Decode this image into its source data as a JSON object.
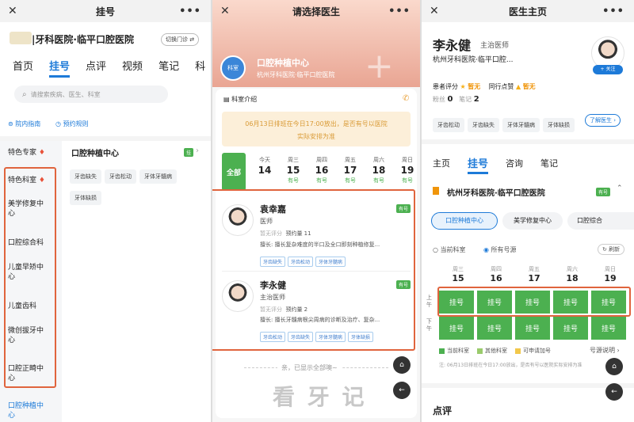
{
  "panel1": {
    "title": "挂号",
    "hospital": "|牙科医院·临平口腔医院",
    "switch_label": "切换门诊",
    "tabs": [
      "首页",
      "挂号",
      "点评",
      "视频",
      "笔记",
      "科"
    ],
    "search_placeholder": "请搜索疾病、医生、科室",
    "guide": "院内指南",
    "rules": "预约规则",
    "categories": [
      "特色专家",
      "特色科室",
      "美学修复中心",
      "口腔综合科",
      "儿童早矫中心",
      "儿童齿科",
      "微创拔牙中心",
      "口腔正畸中心",
      "口腔种植中心"
    ],
    "dept_title": "口腔种植中心",
    "dept_badge": "挂",
    "chips": [
      "牙齿缺失",
      "牙齿松动",
      "牙体牙髓病",
      "牙体缺损"
    ]
  },
  "panel2": {
    "title": "请选择医生",
    "center_name": "口腔种植中心",
    "center_hospital": "杭州牙科医院·临平口腔医院",
    "center_logo": "科室",
    "intro": "科室介绍",
    "notice_line1": "06月13日排班在今日17:00放出，是否有号以医院",
    "notice_line2": "实际安排为准",
    "all_label": "全部",
    "days": [
      {
        "wk": "今天",
        "d": "14",
        "s": ""
      },
      {
        "wk": "周三",
        "d": "15",
        "s": "有号"
      },
      {
        "wk": "周四",
        "d": "16",
        "s": "有号"
      },
      {
        "wk": "周五",
        "d": "17",
        "s": "有号"
      },
      {
        "wk": "周六",
        "d": "18",
        "s": "有号"
      },
      {
        "wk": "周日",
        "d": "19",
        "s": "有号"
      }
    ],
    "doctors": [
      {
        "name": "袁幸嘉",
        "title": "医师",
        "rating": "暂无评分",
        "booked": "预约量 11",
        "specialty": "擅长: 擅长复杂难度的半口及全口即刻种植修复...",
        "tags": [
          "牙齿缺失",
          "牙齿松动",
          "牙体牙髓病"
        ],
        "badge": "有号"
      },
      {
        "name": "李永健",
        "title": "主治医师",
        "rating": "暂无评分",
        "booked": "预约量 2",
        "specialty": "擅长: 擅长牙髓病根尖周病的诊断及治疗、复杂...",
        "tags": [
          "牙齿松动",
          "牙齿缺失",
          "牙体牙髓病",
          "牙体缺损"
        ],
        "badge": "有号"
      }
    ],
    "end_text": "亲，已显示全部噢~",
    "watermark": "看 牙 记",
    "home_label": "首页",
    "back_label": "返回"
  },
  "panel3": {
    "title": "医生主页",
    "name": "李永健",
    "position": "主治医师",
    "hospital": "杭州牙科医院·临平口腔...",
    "follow": "+ 关注",
    "rating_label": "患者评分",
    "rating_value": "暂无",
    "peer_label": "同行点赞",
    "peer_value": "暂无",
    "fans_label": "粉丝",
    "fans_value": "0",
    "notes_label": "笔记",
    "notes_value": "2",
    "tags": [
      "牙齿松动",
      "牙齿缺失",
      "牙体牙髓病",
      "牙体缺损"
    ],
    "learn_more": "了解医生",
    "tabs": [
      "主页",
      "挂号",
      "咨询",
      "笔记"
    ],
    "hospital_line": "杭州牙科医院·临平口腔医院",
    "hospital_badge": "有号",
    "depts": [
      "口腔种植中心",
      "美学修复中心",
      "口腔综合"
    ],
    "current_dept": "当前科室",
    "all_slots": "所有号源",
    "refresh": "刷新",
    "days": [
      {
        "wk": "周三",
        "d": "15"
      },
      {
        "wk": "周四",
        "d": "16"
      },
      {
        "wk": "周五",
        "d": "17"
      },
      {
        "wk": "周六",
        "d": "18"
      },
      {
        "wk": "周日",
        "d": "19"
      }
    ],
    "am": "上午",
    "pm": "下午",
    "slot": "挂号",
    "legend": [
      "当前科室",
      "其他科室",
      "可申请加号"
    ],
    "legend_colors": [
      "#4cb050",
      "#9acb6c",
      "#f2c84b"
    ],
    "source_note": "号源说明",
    "note": "注: 06月13日排班在今日17:00放出，是否有号以医院实际安排为准",
    "review": "点评",
    "home_label": "首页",
    "back_label": "返回"
  }
}
